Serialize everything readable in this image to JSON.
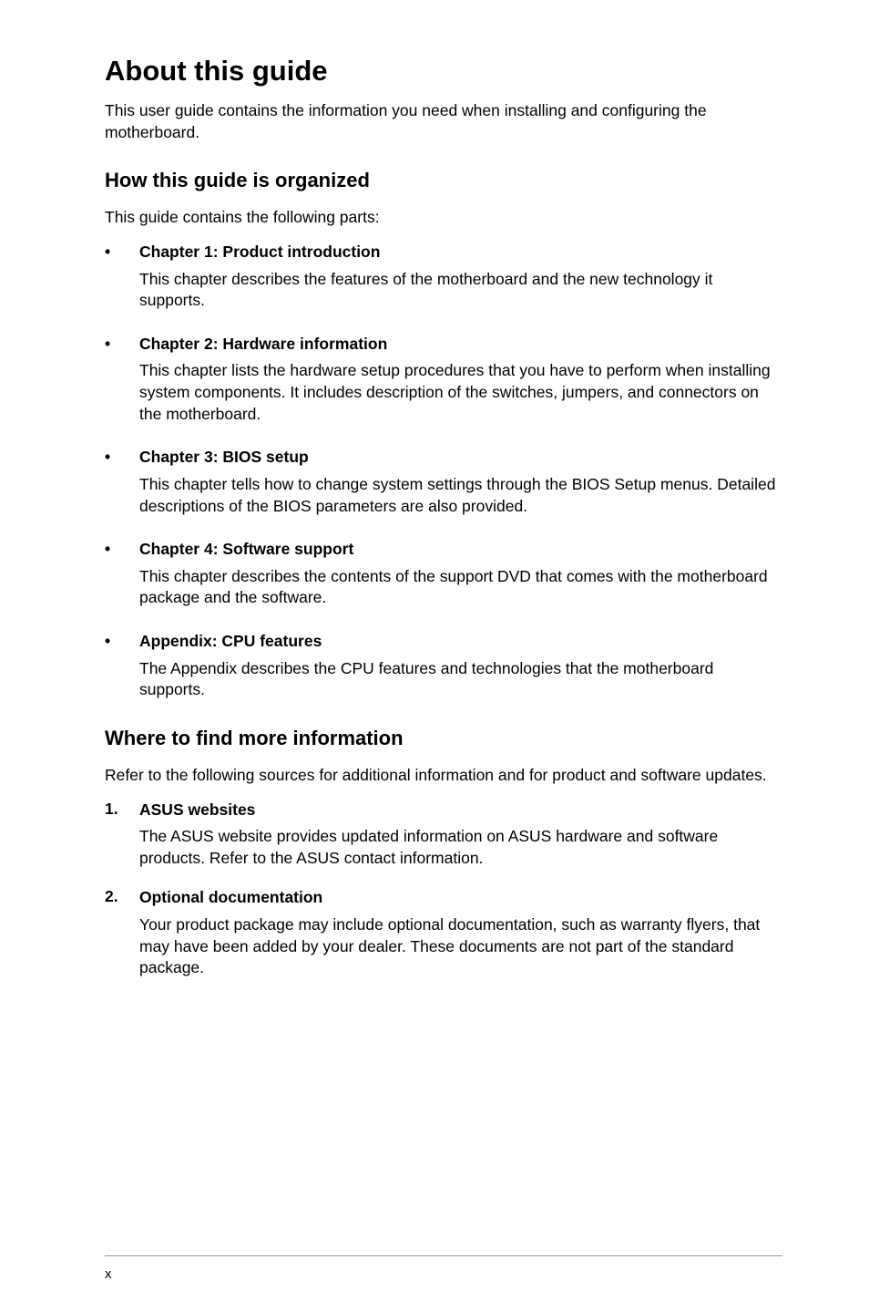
{
  "title": "About this guide",
  "intro": "This user guide contains the information you need when installing and configuring the motherboard.",
  "section1": {
    "heading": "How this guide is organized",
    "intro": "This guide contains the following parts:",
    "items": [
      {
        "marker": "•",
        "heading": "Chapter 1: Product introduction",
        "body": "This chapter describes the features of the motherboard and the new technology it supports."
      },
      {
        "marker": "•",
        "heading": "Chapter 2: Hardware information",
        "body": "This chapter lists the hardware setup procedures that you have to perform when installing system components. It includes description of the switches, jumpers, and connectors on the motherboard."
      },
      {
        "marker": "•",
        "heading": "Chapter 3: BIOS setup",
        "body": "This chapter tells how to change system settings through the BIOS Setup menus. Detailed descriptions of the BIOS parameters are also provided."
      },
      {
        "marker": "•",
        "heading": "Chapter 4: Software support",
        "body": "This chapter describes the contents of the support DVD that comes with the motherboard package and the software."
      },
      {
        "marker": "•",
        "heading": "Appendix: CPU features",
        "body": "The Appendix describes the CPU features and technologies that the motherboard supports."
      }
    ]
  },
  "section2": {
    "heading": "Where to find more information",
    "intro": "Refer to the following sources for additional information and for product and software updates.",
    "items": [
      {
        "marker": "1.",
        "heading": "ASUS websites",
        "body": "The ASUS website provides updated information on ASUS hardware and software products. Refer to the ASUS contact information."
      },
      {
        "marker": "2.",
        "heading": "Optional documentation",
        "body": "Your product package may include optional documentation, such as warranty flyers, that may have been added by your dealer. These documents are not part of the standard package."
      }
    ]
  },
  "page_number": "x"
}
